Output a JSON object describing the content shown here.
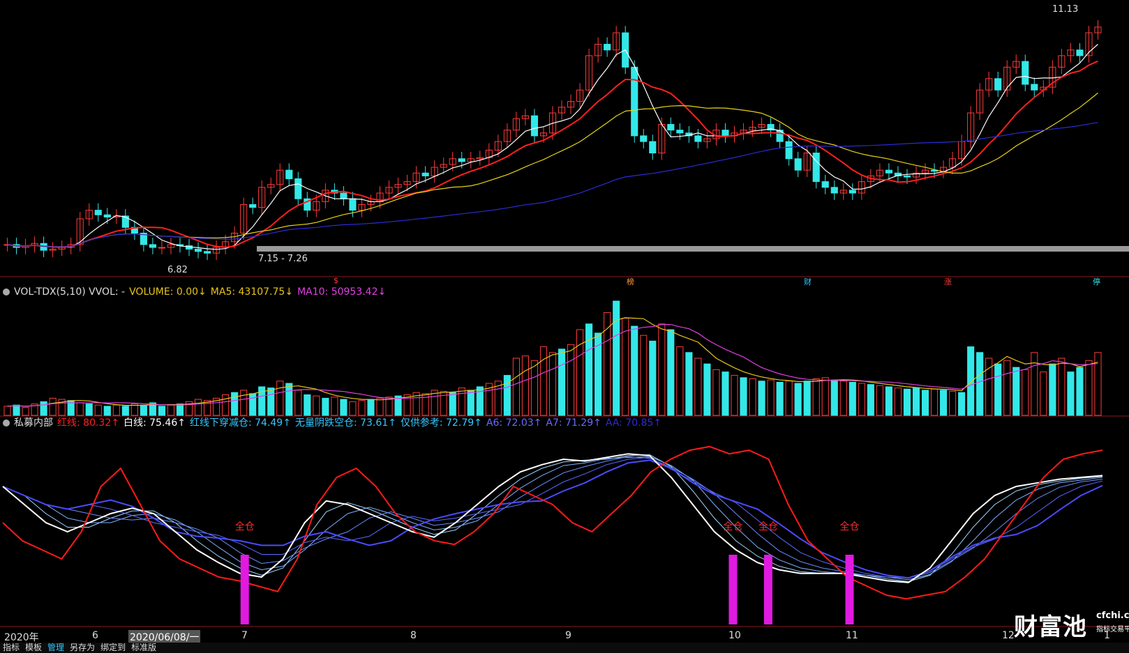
{
  "chart_data": {
    "type": "candlestick",
    "price_panel": {
      "high_label": "11.13",
      "low_label": "6.82",
      "range_label": "7.15 - 7.26",
      "events": [
        {
          "text": "$",
          "color": "#ff3b3b"
        },
        {
          "text": "榜",
          "color": "#ff9a3b"
        },
        {
          "text": "财",
          "color": "#33c8ff"
        },
        {
          "text": "涨",
          "color": "#ff3b3b"
        },
        {
          "text": "停",
          "color": "#33e8e8"
        }
      ],
      "closes": [
        7.1,
        7.05,
        7.08,
        7.12,
        7.0,
        7.02,
        7.05,
        7.1,
        7.55,
        7.7,
        7.62,
        7.58,
        7.6,
        7.4,
        7.3,
        7.1,
        7.05,
        7.05,
        7.1,
        7.08,
        7.02,
        6.98,
        6.95,
        7.05,
        7.15,
        7.3,
        7.8,
        7.75,
        8.1,
        8.15,
        8.4,
        8.25,
        7.9,
        7.7,
        7.85,
        8.05,
        8.0,
        7.9,
        7.7,
        7.8,
        7.85,
        8.0,
        8.1,
        8.15,
        8.2,
        8.35,
        8.3,
        8.45,
        8.5,
        8.6,
        8.55,
        8.6,
        8.62,
        8.75,
        8.9,
        9.1,
        9.3,
        9.35,
        9.0,
        9.05,
        9.4,
        9.5,
        9.6,
        9.8,
        10.4,
        10.6,
        10.5,
        10.8,
        10.2,
        9.0,
        8.9,
        8.7,
        9.2,
        9.1,
        9.05,
        9.0,
        8.9,
        8.95,
        9.1,
        9.0,
        9.05,
        9.1,
        9.15,
        9.2,
        9.1,
        8.9,
        8.6,
        8.4,
        8.7,
        8.2,
        8.1,
        8.0,
        8.05,
        8.0,
        8.2,
        8.3,
        8.4,
        8.35,
        8.3,
        8.28,
        8.35,
        8.4,
        8.38,
        8.45,
        8.6,
        8.9,
        9.4,
        9.8,
        10.0,
        9.8,
        10.2,
        10.3,
        9.9,
        9.8,
        9.85,
        10.2,
        10.4,
        10.5,
        10.4,
        10.8,
        10.9
      ],
      "ma_series": [
        {
          "name": "MA5",
          "color": "#ffffff"
        },
        {
          "name": "MA10",
          "color": "#ff2020"
        },
        {
          "name": "MA20",
          "color": "#e6d21a"
        },
        {
          "name": "MA60",
          "color": "#2b2bd6"
        }
      ],
      "ylim": [
        6.6,
        11.3
      ]
    },
    "volume_panel": {
      "header": {
        "name": "VOL-TDX(5,10) VVOL: -",
        "volume": "VOLUME: 0.00↓",
        "ma5": "MA5: 43107.75↓",
        "ma10": "MA10: 50953.42↓"
      },
      "values": [
        8,
        9,
        7,
        10,
        12,
        15,
        14,
        13,
        11,
        10,
        9,
        8,
        9,
        8,
        10,
        9,
        11,
        8,
        9,
        10,
        12,
        14,
        13,
        15,
        18,
        20,
        22,
        19,
        25,
        24,
        30,
        28,
        22,
        18,
        17,
        15,
        16,
        14,
        12,
        13,
        14,
        15,
        16,
        17,
        18,
        20,
        19,
        22,
        21,
        20,
        24,
        22,
        25,
        28,
        30,
        35,
        50,
        52,
        48,
        60,
        55,
        58,
        62,
        75,
        80,
        72,
        90,
        100,
        85,
        78,
        70,
        65,
        80,
        75,
        60,
        55,
        50,
        45,
        40,
        38,
        35,
        33,
        32,
        30,
        31,
        29,
        30,
        28,
        30,
        32,
        33,
        31,
        30,
        29,
        28,
        27,
        26,
        25,
        24,
        23,
        24,
        22,
        23,
        22,
        21,
        20,
        60,
        55,
        50,
        45,
        48,
        42,
        40,
        55,
        38,
        45,
        50,
        38,
        42,
        48,
        55
      ]
    },
    "indicator_panel": {
      "header": {
        "name": "私募内部",
        "red": "红线: 80.32↑",
        "white": "白线: 75.46↑",
        "cross": "红线下穿减仓: 74.49↑",
        "noyin": "无量阴跌空仓: 73.61↑",
        "ref": "仅供参考: 72.79↑",
        "a6": "A6: 72.03↑",
        "a7": "A7: 71.29↑",
        "aa": "AA: 70.85↑"
      },
      "full_position_label": "全仓",
      "red_line": [
        50,
        40,
        35,
        30,
        45,
        70,
        80,
        60,
        40,
        30,
        25,
        20,
        18,
        15,
        12,
        30,
        60,
        75,
        80,
        70,
        55,
        45,
        40,
        38,
        45,
        55,
        70,
        65,
        60,
        50,
        45,
        55,
        65,
        78,
        85,
        90,
        92,
        88,
        90,
        85,
        60,
        40,
        30,
        20,
        15,
        10,
        8,
        10,
        12,
        20,
        30,
        45,
        60,
        75,
        85,
        88,
        90
      ],
      "white_line": [
        70,
        60,
        50,
        45,
        50,
        55,
        58,
        55,
        45,
        35,
        28,
        22,
        20,
        30,
        50,
        62,
        60,
        55,
        50,
        45,
        42,
        50,
        60,
        70,
        78,
        82,
        85,
        84,
        86,
        88,
        87,
        75,
        60,
        45,
        35,
        28,
        24,
        22,
        22,
        22,
        20,
        18,
        17,
        25,
        40,
        55,
        65,
        70,
        72,
        74,
        75,
        76
      ],
      "fill_signals": [
        0.22,
        0.664,
        0.696,
        0.77
      ]
    }
  },
  "x_axis": {
    "labels": [
      "2020年",
      "6",
      "2020/06/08/一",
      "7",
      "8",
      "9",
      "10",
      "11",
      "12",
      "1"
    ]
  },
  "toolbar": [
    "指标",
    "模板",
    "管理",
    "另存为",
    "绑定到",
    "标准版"
  ],
  "watermark": {
    "brand": "财富池",
    "site": "cfchi.com",
    "tagline": "指标交易平台"
  }
}
